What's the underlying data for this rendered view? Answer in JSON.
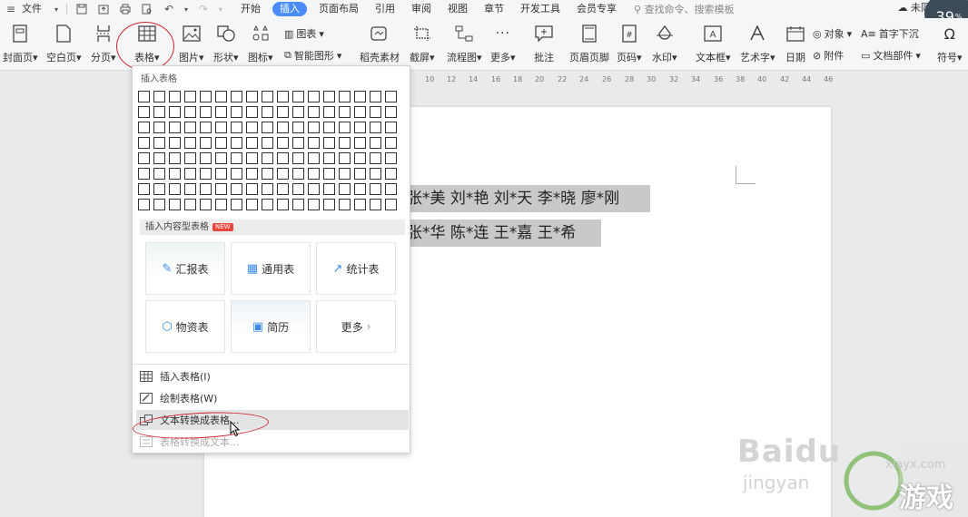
{
  "menubar": {
    "file": "文件",
    "tabs": [
      {
        "label": "开始",
        "active": false
      },
      {
        "label": "插入",
        "active": true
      },
      {
        "label": "页面布局",
        "active": false
      },
      {
        "label": "引用",
        "active": false
      },
      {
        "label": "审阅",
        "active": false
      },
      {
        "label": "视图",
        "active": false
      },
      {
        "label": "章节",
        "active": false
      },
      {
        "label": "开发工具",
        "active": false
      },
      {
        "label": "会员专享",
        "active": false
      }
    ],
    "search_placeholder": "查找命令、搜索模板",
    "sync_status": "未同步"
  },
  "zoom": {
    "value": "39",
    "unit": "%"
  },
  "ribbon": {
    "cover_page": "封面页",
    "blank_page": "空白页",
    "page_break": "分页",
    "table": "表格",
    "picture": "图片",
    "shape": "形状",
    "icon": "图标",
    "chart": "图表",
    "smart_art": "智能图形",
    "docer_material": "稻壳素材",
    "screenshot": "截屏",
    "flowchart": "流程图",
    "more": "更多",
    "comment": "批注",
    "header_footer": "页眉页脚",
    "page_number": "页码",
    "watermark": "水印",
    "textbox": "文本框",
    "word_art": "艺术字",
    "date": "日期",
    "object": "对象",
    "drop_cap": "首字下沉",
    "attachment": "附件",
    "doc_parts": "文档部件",
    "symbol": "符号"
  },
  "ruler": {
    "ticks": [
      "10",
      "12",
      "14",
      "16",
      "18",
      "20",
      "22",
      "24",
      "26",
      "28",
      "30",
      "32",
      "34",
      "36",
      "38",
      "40",
      "42",
      "44",
      "46"
    ]
  },
  "document": {
    "line1": "张*美  刘*艳  刘*天  李*晓  廖*刚",
    "line2": "张*华  陈*连  王*嘉  王*希"
  },
  "table_menu": {
    "insert_table_title": "插入表格",
    "grid_cols": 17,
    "grid_rows": 8,
    "content_tables_title": "插入内容型表格",
    "new_badge": "NEW",
    "cards": [
      {
        "label": "汇报表",
        "icon": "edit-icon"
      },
      {
        "label": "通用表",
        "icon": "grid-icon"
      },
      {
        "label": "统计表",
        "icon": "chart-line-icon"
      },
      {
        "label": "物资表",
        "icon": "box-icon"
      },
      {
        "label": "简历",
        "icon": "resume-icon"
      },
      {
        "label": "更多",
        "icon": "chevron-right-icon"
      }
    ],
    "items": [
      {
        "label": "插入表格(I)",
        "icon": "table-icon",
        "state": "normal"
      },
      {
        "label": "绘制表格(W)",
        "icon": "pencil-table-icon",
        "state": "normal"
      },
      {
        "label": "文本转换成表格...",
        "icon": "convert-icon",
        "state": "hover"
      },
      {
        "label": "表格转换成文本...",
        "icon": "convert-back-icon",
        "state": "disabled"
      }
    ]
  },
  "watermark": {
    "baidu": "Baidu",
    "jingyan": "jingyan",
    "site_url": "xlayx.com",
    "site_name": "游戏"
  },
  "colors": {
    "accent": "#4a8df8",
    "annotation_red": "#d0262f",
    "selection_gray": "#c9c9c9"
  }
}
